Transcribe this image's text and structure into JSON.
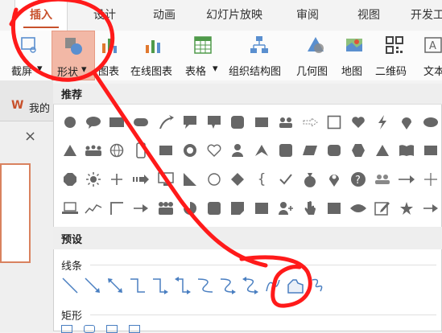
{
  "ribbon_tabs": {
    "insert": "插入",
    "design": "设计",
    "animation": "动画",
    "slideshow": "幻灯片放映",
    "review": "审阅",
    "view": "视图",
    "developer": "开发工"
  },
  "ribbon_buttons": {
    "screenshot": "截屏",
    "shapes": "形状",
    "chart": "图表",
    "online_chart": "在线图表",
    "table": "表格",
    "org_chart": "组织结构图",
    "geometry": "几何图",
    "map": "地图",
    "qrcode": "二维码",
    "text": "文本"
  },
  "left_panel": {
    "brand_text": "我的"
  },
  "shapes_panel": {
    "recommend_header": "推荐",
    "preset_header": "预设",
    "lines_label": "线条",
    "rect_label": "矩形"
  },
  "colors": {
    "accent": "#c8512c",
    "annotation": "#ff1a1a"
  }
}
